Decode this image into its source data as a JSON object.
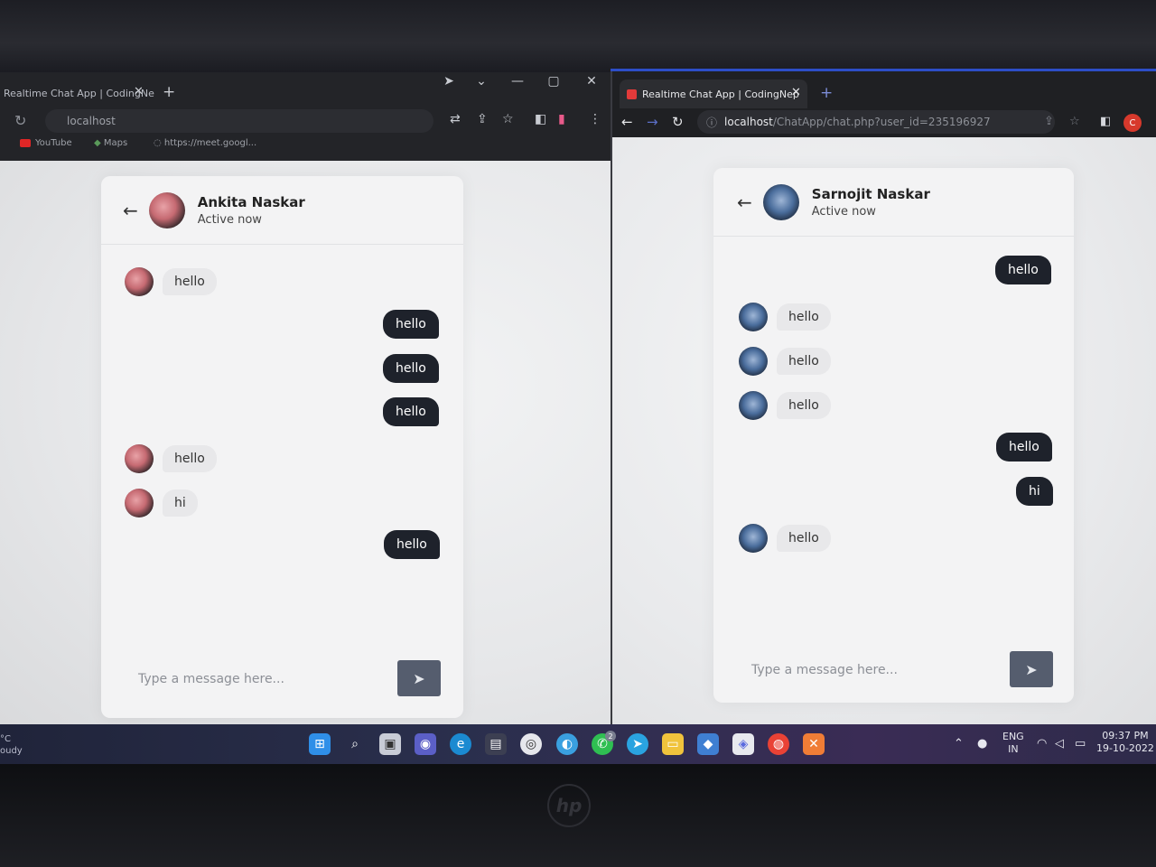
{
  "left_window": {
    "tab_title": "Realtime Chat App | CodingNe",
    "url": "localhost",
    "bookmarks": [
      "YouTube",
      "Maps",
      "https://meet.googl..."
    ],
    "chat": {
      "contact_name": "Ankita Naskar",
      "contact_status": "Active now",
      "messages": [
        {
          "dir": "in",
          "text": "hello"
        },
        {
          "dir": "out",
          "text": "hello"
        },
        {
          "dir": "out",
          "text": "hello"
        },
        {
          "dir": "out",
          "text": "hello"
        },
        {
          "dir": "in",
          "text": "hello"
        },
        {
          "dir": "in",
          "text": "hi"
        },
        {
          "dir": "out",
          "text": "hello"
        }
      ],
      "input_placeholder": "Type a message here..."
    }
  },
  "right_window": {
    "tab_title": "Realtime Chat App | CodingNep",
    "url_host": "localhost",
    "url_path": "/ChatApp/chat.php?user_id=235196927",
    "profile_initial": "C",
    "chat": {
      "contact_name": "Sarnojit Naskar",
      "contact_status": "Active now",
      "messages": [
        {
          "dir": "out",
          "text": "hello"
        },
        {
          "dir": "in",
          "text": "hello"
        },
        {
          "dir": "in",
          "text": "hello"
        },
        {
          "dir": "in",
          "text": "hello"
        },
        {
          "dir": "out",
          "text": "hello"
        },
        {
          "dir": "out",
          "text": "hi"
        },
        {
          "dir": "in",
          "text": "hello"
        }
      ],
      "input_placeholder": "Type a message here..."
    }
  },
  "taskbar": {
    "weather": [
      "°C",
      "oudy"
    ],
    "language": "ENG",
    "region": "IN",
    "time": "09:37 PM",
    "date": "19-10-2022",
    "whatsapp_badge": "2"
  },
  "colors": {
    "outgoing_bubble": "#1e222b",
    "incoming_bubble": "#e8e8ea",
    "send_button": "#555d6e",
    "chrome_accent": "#2d4ec7"
  }
}
